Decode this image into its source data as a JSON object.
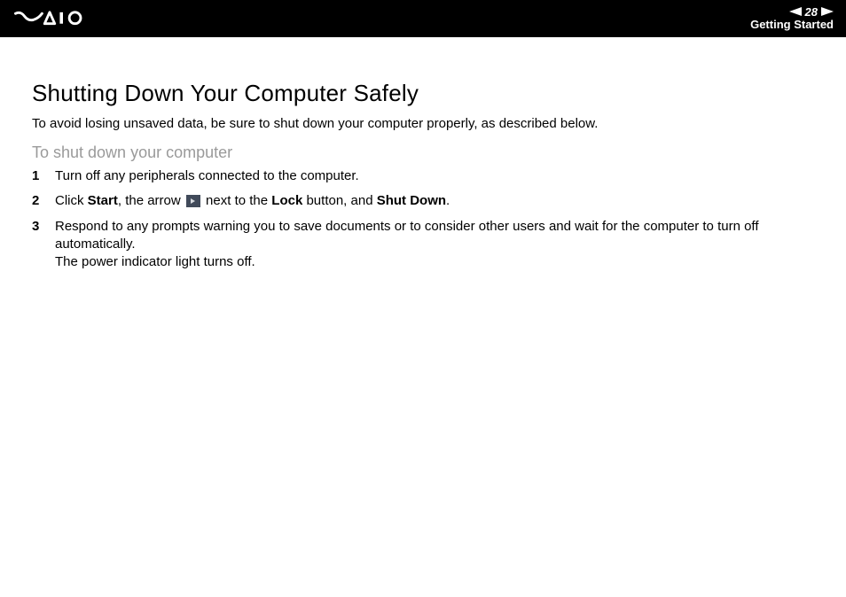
{
  "header": {
    "page_number": "28",
    "section": "Getting Started"
  },
  "main": {
    "title": "Shutting Down Your Computer Safely",
    "intro": "To avoid losing unsaved data, be sure to shut down your computer properly, as described below.",
    "subheading": "To shut down your computer",
    "steps": [
      {
        "num": "1",
        "text": "Turn off any peripherals connected to the computer."
      },
      {
        "num": "2",
        "pre": "Click ",
        "b1": "Start",
        "mid1": ", the arrow ",
        "mid2": " next to the ",
        "b2": "Lock",
        "mid3": " button, and ",
        "b3": "Shut Down",
        "post": "."
      },
      {
        "num": "3",
        "line1": "Respond to any prompts warning you to save documents or to consider other users and wait for the computer to turn off automatically.",
        "line2": "The power indicator light turns off."
      }
    ]
  }
}
